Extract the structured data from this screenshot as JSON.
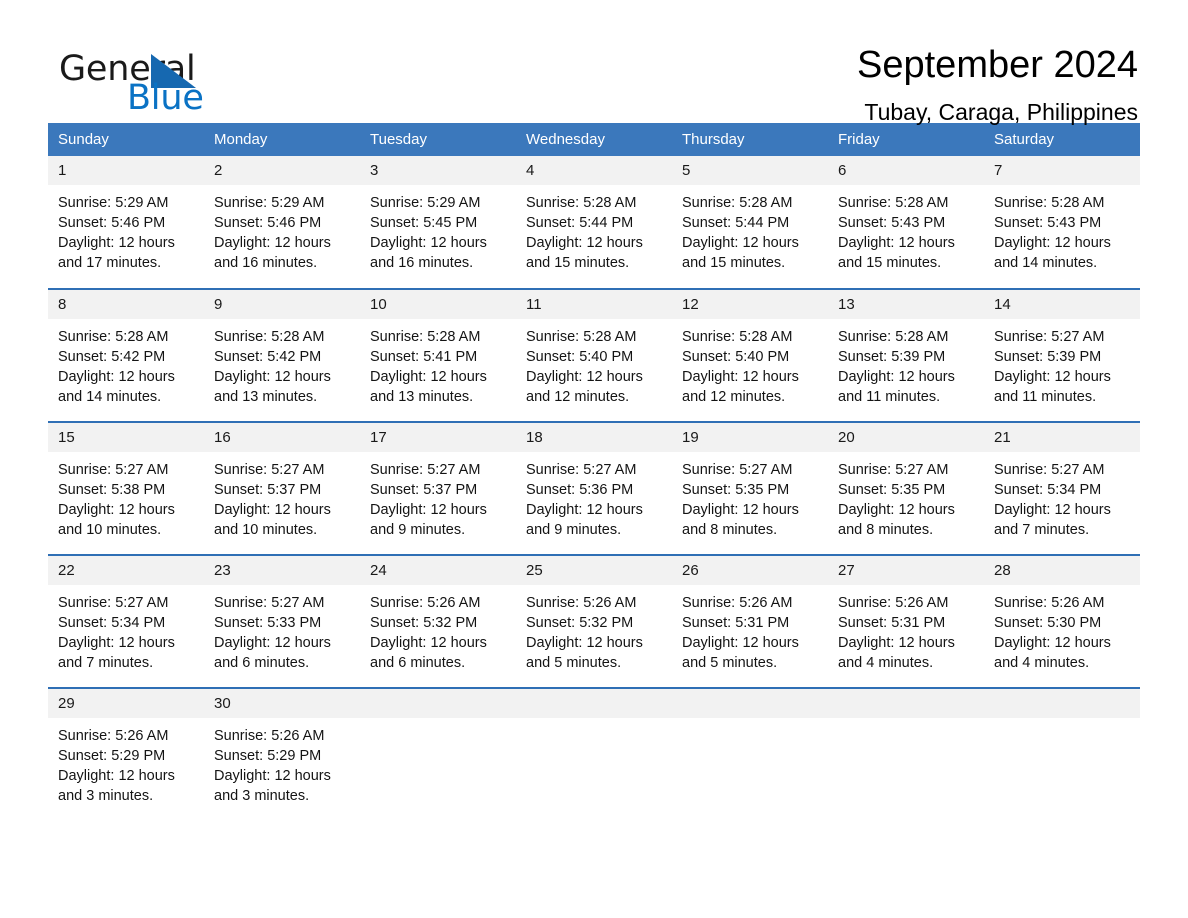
{
  "brand": {
    "name_part1": "General",
    "name_part2": "Blue",
    "triangle_icon": "triangle-icon",
    "accent_color": "#1668b0"
  },
  "header": {
    "title": "September 2024",
    "location": "Tubay, Caraga, Philippines"
  },
  "colors": {
    "header_row_bg": "#3b78bc",
    "day_number_bg": "#f2f2f2",
    "row_divider": "#2f6fb5",
    "brand_blue": "#0a72c4"
  },
  "weekday_headers": [
    "Sunday",
    "Monday",
    "Tuesday",
    "Wednesday",
    "Thursday",
    "Friday",
    "Saturday"
  ],
  "weeks": [
    [
      {
        "day": "1",
        "sunrise": "Sunrise: 5:29 AM",
        "sunset": "Sunset: 5:46 PM",
        "daylight_1": "Daylight: 12 hours",
        "daylight_2": "and 17 minutes."
      },
      {
        "day": "2",
        "sunrise": "Sunrise: 5:29 AM",
        "sunset": "Sunset: 5:46 PM",
        "daylight_1": "Daylight: 12 hours",
        "daylight_2": "and 16 minutes."
      },
      {
        "day": "3",
        "sunrise": "Sunrise: 5:29 AM",
        "sunset": "Sunset: 5:45 PM",
        "daylight_1": "Daylight: 12 hours",
        "daylight_2": "and 16 minutes."
      },
      {
        "day": "4",
        "sunrise": "Sunrise: 5:28 AM",
        "sunset": "Sunset: 5:44 PM",
        "daylight_1": "Daylight: 12 hours",
        "daylight_2": "and 15 minutes."
      },
      {
        "day": "5",
        "sunrise": "Sunrise: 5:28 AM",
        "sunset": "Sunset: 5:44 PM",
        "daylight_1": "Daylight: 12 hours",
        "daylight_2": "and 15 minutes."
      },
      {
        "day": "6",
        "sunrise": "Sunrise: 5:28 AM",
        "sunset": "Sunset: 5:43 PM",
        "daylight_1": "Daylight: 12 hours",
        "daylight_2": "and 15 minutes."
      },
      {
        "day": "7",
        "sunrise": "Sunrise: 5:28 AM",
        "sunset": "Sunset: 5:43 PM",
        "daylight_1": "Daylight: 12 hours",
        "daylight_2": "and 14 minutes."
      }
    ],
    [
      {
        "day": "8",
        "sunrise": "Sunrise: 5:28 AM",
        "sunset": "Sunset: 5:42 PM",
        "daylight_1": "Daylight: 12 hours",
        "daylight_2": "and 14 minutes."
      },
      {
        "day": "9",
        "sunrise": "Sunrise: 5:28 AM",
        "sunset": "Sunset: 5:42 PM",
        "daylight_1": "Daylight: 12 hours",
        "daylight_2": "and 13 minutes."
      },
      {
        "day": "10",
        "sunrise": "Sunrise: 5:28 AM",
        "sunset": "Sunset: 5:41 PM",
        "daylight_1": "Daylight: 12 hours",
        "daylight_2": "and 13 minutes."
      },
      {
        "day": "11",
        "sunrise": "Sunrise: 5:28 AM",
        "sunset": "Sunset: 5:40 PM",
        "daylight_1": "Daylight: 12 hours",
        "daylight_2": "and 12 minutes."
      },
      {
        "day": "12",
        "sunrise": "Sunrise: 5:28 AM",
        "sunset": "Sunset: 5:40 PM",
        "daylight_1": "Daylight: 12 hours",
        "daylight_2": "and 12 minutes."
      },
      {
        "day": "13",
        "sunrise": "Sunrise: 5:28 AM",
        "sunset": "Sunset: 5:39 PM",
        "daylight_1": "Daylight: 12 hours",
        "daylight_2": "and 11 minutes."
      },
      {
        "day": "14",
        "sunrise": "Sunrise: 5:27 AM",
        "sunset": "Sunset: 5:39 PM",
        "daylight_1": "Daylight: 12 hours",
        "daylight_2": "and 11 minutes."
      }
    ],
    [
      {
        "day": "15",
        "sunrise": "Sunrise: 5:27 AM",
        "sunset": "Sunset: 5:38 PM",
        "daylight_1": "Daylight: 12 hours",
        "daylight_2": "and 10 minutes."
      },
      {
        "day": "16",
        "sunrise": "Sunrise: 5:27 AM",
        "sunset": "Sunset: 5:37 PM",
        "daylight_1": "Daylight: 12 hours",
        "daylight_2": "and 10 minutes."
      },
      {
        "day": "17",
        "sunrise": "Sunrise: 5:27 AM",
        "sunset": "Sunset: 5:37 PM",
        "daylight_1": "Daylight: 12 hours",
        "daylight_2": "and 9 minutes."
      },
      {
        "day": "18",
        "sunrise": "Sunrise: 5:27 AM",
        "sunset": "Sunset: 5:36 PM",
        "daylight_1": "Daylight: 12 hours",
        "daylight_2": "and 9 minutes."
      },
      {
        "day": "19",
        "sunrise": "Sunrise: 5:27 AM",
        "sunset": "Sunset: 5:35 PM",
        "daylight_1": "Daylight: 12 hours",
        "daylight_2": "and 8 minutes."
      },
      {
        "day": "20",
        "sunrise": "Sunrise: 5:27 AM",
        "sunset": "Sunset: 5:35 PM",
        "daylight_1": "Daylight: 12 hours",
        "daylight_2": "and 8 minutes."
      },
      {
        "day": "21",
        "sunrise": "Sunrise: 5:27 AM",
        "sunset": "Sunset: 5:34 PM",
        "daylight_1": "Daylight: 12 hours",
        "daylight_2": "and 7 minutes."
      }
    ],
    [
      {
        "day": "22",
        "sunrise": "Sunrise: 5:27 AM",
        "sunset": "Sunset: 5:34 PM",
        "daylight_1": "Daylight: 12 hours",
        "daylight_2": "and 7 minutes."
      },
      {
        "day": "23",
        "sunrise": "Sunrise: 5:27 AM",
        "sunset": "Sunset: 5:33 PM",
        "daylight_1": "Daylight: 12 hours",
        "daylight_2": "and 6 minutes."
      },
      {
        "day": "24",
        "sunrise": "Sunrise: 5:26 AM",
        "sunset": "Sunset: 5:32 PM",
        "daylight_1": "Daylight: 12 hours",
        "daylight_2": "and 6 minutes."
      },
      {
        "day": "25",
        "sunrise": "Sunrise: 5:26 AM",
        "sunset": "Sunset: 5:32 PM",
        "daylight_1": "Daylight: 12 hours",
        "daylight_2": "and 5 minutes."
      },
      {
        "day": "26",
        "sunrise": "Sunrise: 5:26 AM",
        "sunset": "Sunset: 5:31 PM",
        "daylight_1": "Daylight: 12 hours",
        "daylight_2": "and 5 minutes."
      },
      {
        "day": "27",
        "sunrise": "Sunrise: 5:26 AM",
        "sunset": "Sunset: 5:31 PM",
        "daylight_1": "Daylight: 12 hours",
        "daylight_2": "and 4 minutes."
      },
      {
        "day": "28",
        "sunrise": "Sunrise: 5:26 AM",
        "sunset": "Sunset: 5:30 PM",
        "daylight_1": "Daylight: 12 hours",
        "daylight_2": "and 4 minutes."
      }
    ],
    [
      {
        "day": "29",
        "sunrise": "Sunrise: 5:26 AM",
        "sunset": "Sunset: 5:29 PM",
        "daylight_1": "Daylight: 12 hours",
        "daylight_2": "and 3 minutes."
      },
      {
        "day": "30",
        "sunrise": "Sunrise: 5:26 AM",
        "sunset": "Sunset: 5:29 PM",
        "daylight_1": "Daylight: 12 hours",
        "daylight_2": "and 3 minutes."
      },
      {
        "day": "",
        "sunrise": "",
        "sunset": "",
        "daylight_1": "",
        "daylight_2": ""
      },
      {
        "day": "",
        "sunrise": "",
        "sunset": "",
        "daylight_1": "",
        "daylight_2": ""
      },
      {
        "day": "",
        "sunrise": "",
        "sunset": "",
        "daylight_1": "",
        "daylight_2": ""
      },
      {
        "day": "",
        "sunrise": "",
        "sunset": "",
        "daylight_1": "",
        "daylight_2": ""
      },
      {
        "day": "",
        "sunrise": "",
        "sunset": "",
        "daylight_1": "",
        "daylight_2": ""
      }
    ]
  ]
}
